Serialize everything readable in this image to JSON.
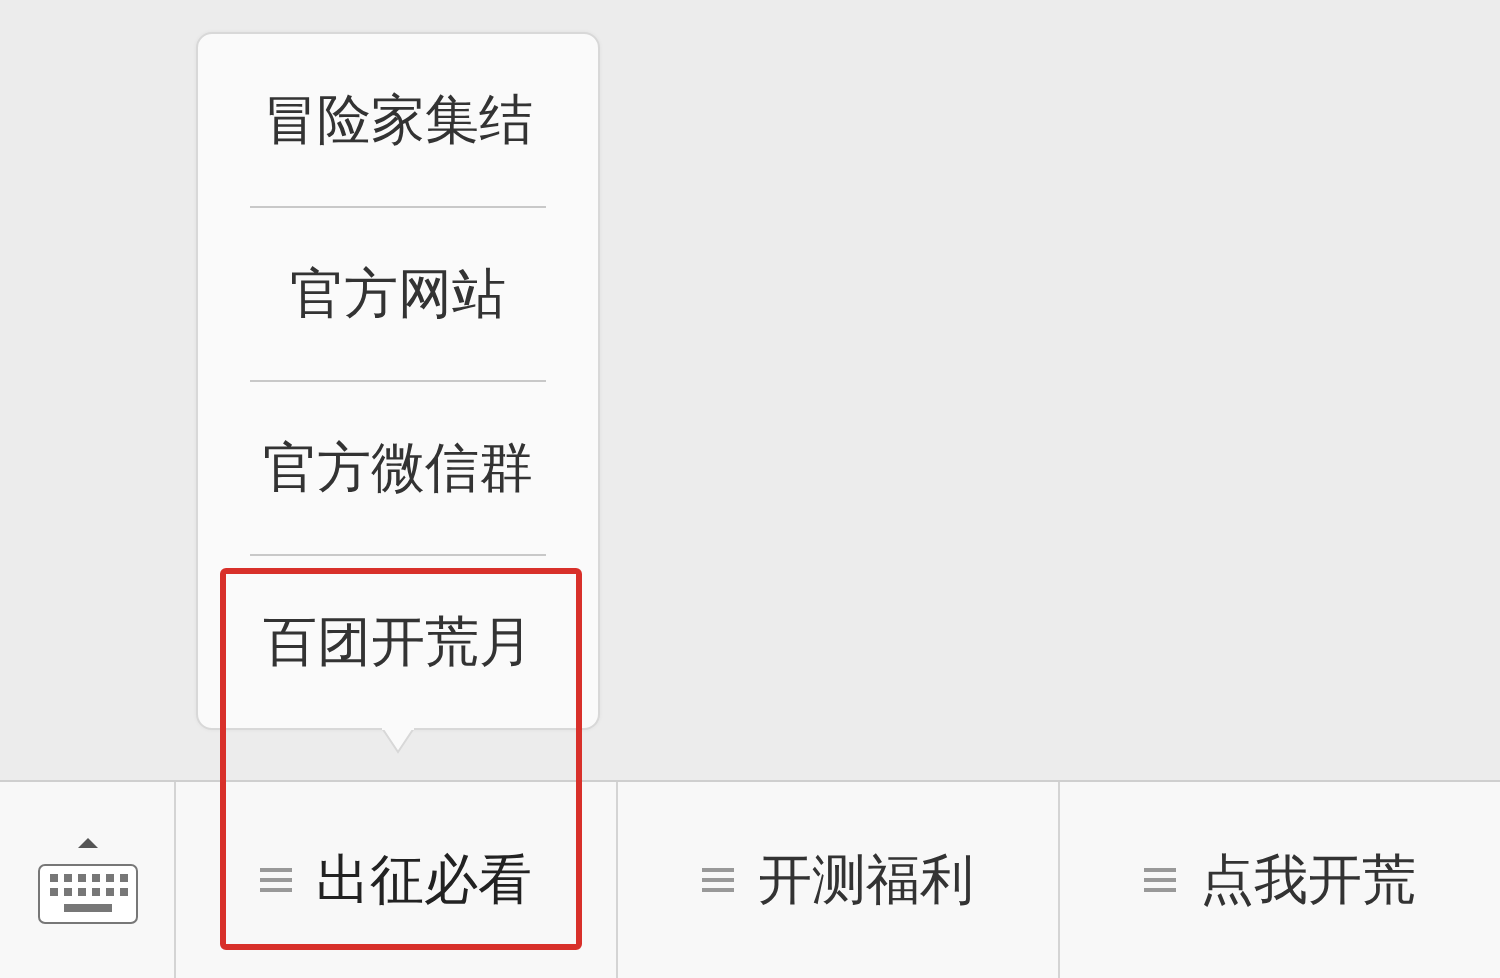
{
  "menu": {
    "items": [
      {
        "label": "出征必看",
        "expanded": true,
        "submenu": [
          "冒险家集结",
          "官方网站",
          "官方微信群",
          "百团开荒月"
        ]
      },
      {
        "label": "开测福利",
        "expanded": false
      },
      {
        "label": "点我开荒",
        "expanded": false
      }
    ]
  },
  "annotation": {
    "kind": "outline"
  }
}
